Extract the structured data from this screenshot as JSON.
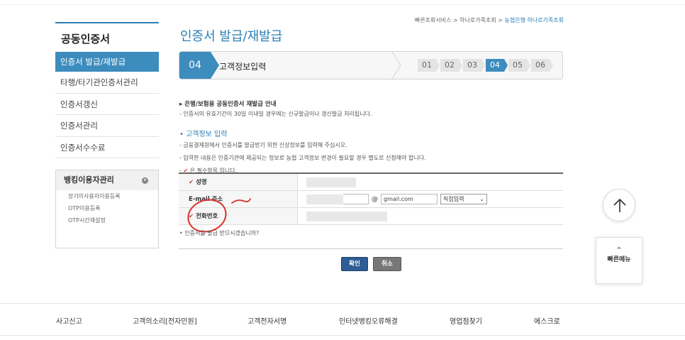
{
  "sidebar": {
    "title": "공동인증서",
    "items": [
      {
        "label": "인증서 발급/재발급",
        "active": true
      },
      {
        "label": "타행/타기관인증서관리"
      },
      {
        "label": "인증서갱신"
      },
      {
        "label": "인증서관리"
      },
      {
        "label": "인증서수수료"
      }
    ],
    "banking": {
      "title": "뱅킹이용자관리",
      "links": [
        "장기미사용자이용등록",
        "OTP이용등록",
        "OTP시간재설정"
      ]
    }
  },
  "breadcrumb": {
    "items": [
      "빠른조회서비스",
      "하나로가족조회"
    ],
    "current": "농협은행 하나로가족조회",
    "sep": " > "
  },
  "page_title": "인증서 발급/재발급",
  "stepbar": {
    "current_number": "04",
    "current_label": "고객정보입력",
    "steps": [
      "01",
      "02",
      "03",
      "04",
      "05",
      "06"
    ],
    "active_index": 3
  },
  "notice": {
    "heading": "은행/보험용 공동인증서 재발급 안내",
    "text": "- 인증서의 유효기간이 30일 이내일 경우에는 신규발급이나 갱신발급 처리됩니다."
  },
  "customer_section": {
    "title": "• 고객정보 입력",
    "lines": [
      "- 금융결제원에서 인증서를 발급받기 위한 신상정보를 입력해 주십시오.",
      "- 입력한 내용은 인증기관에 제공되는 정보로 농협 고객정보 변경이 필요할 경우 별도로 신청해야 합니다.",
      "은 필수항목 입니다."
    ]
  },
  "form": {
    "name_label": "성명",
    "email_label": "E-mail 주소",
    "email_at": "@",
    "email_domain": "gmail.com",
    "email_select": "직접입력",
    "phone_label": "전화번호"
  },
  "question": "• 인증서를 발급 받으시겠습니까?",
  "buttons": {
    "confirm": "확인",
    "cancel": "취소"
  },
  "quick_menu": "빠른메뉴",
  "footer": [
    "사고신고",
    "고객의소리[전자민원]",
    "고객전자서명",
    "인터넷뱅킹오류해결",
    "영업점찾기",
    "에스크로"
  ],
  "colors": {
    "accent": "#3c8cbe",
    "required": "#d0402f",
    "annotation": "#d9302a"
  }
}
